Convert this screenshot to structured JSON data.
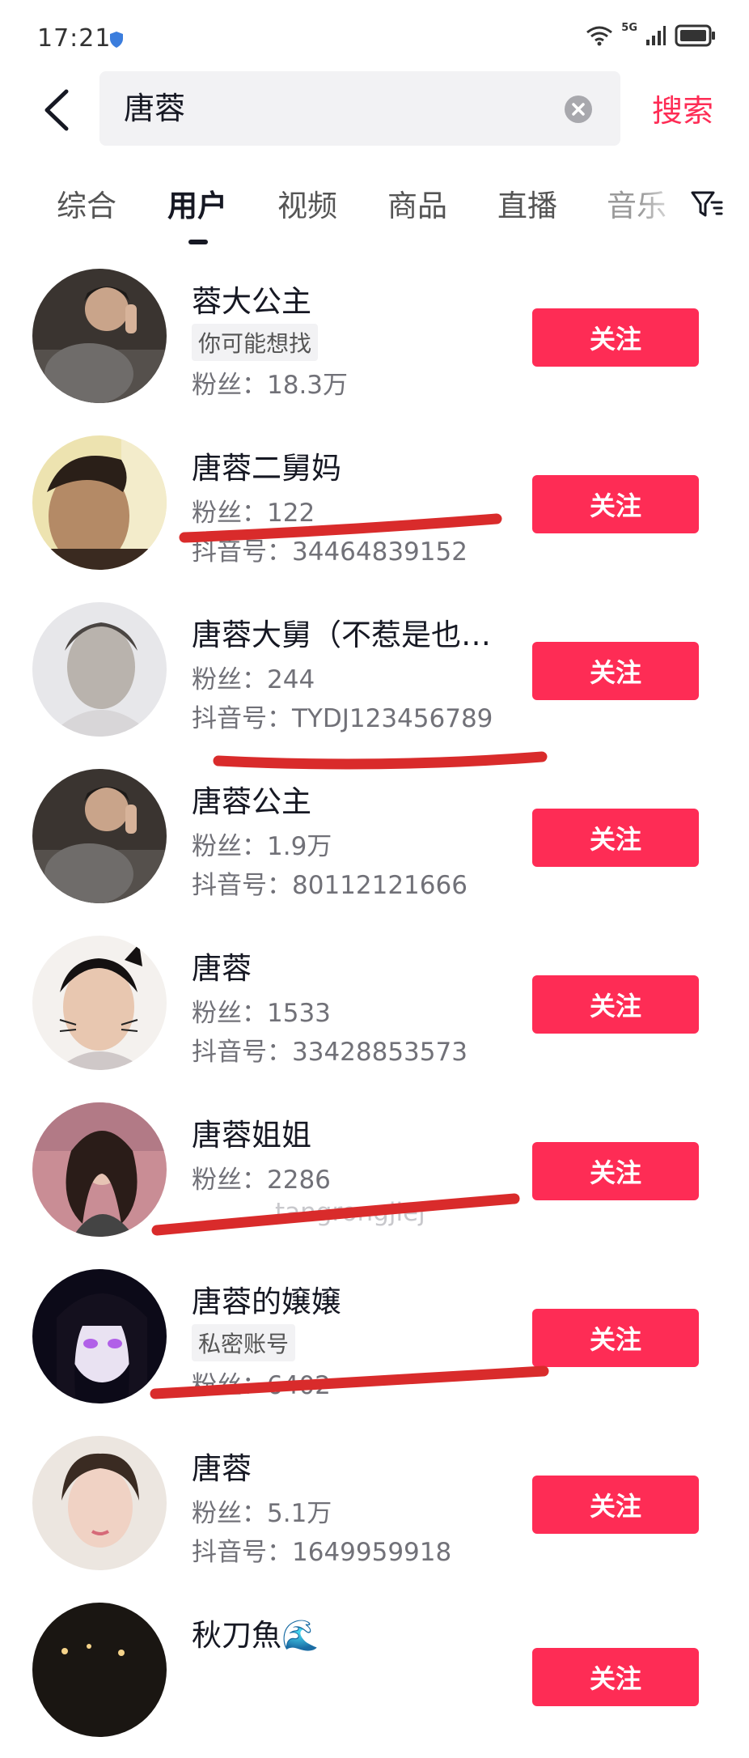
{
  "status_bar": {
    "time": "17:21",
    "network": "5G"
  },
  "search": {
    "query": "唐蓉",
    "submit_label": "搜索"
  },
  "tabs": [
    {
      "label": "综合"
    },
    {
      "label": "用户"
    },
    {
      "label": "视频"
    },
    {
      "label": "商品"
    },
    {
      "label": "直播"
    },
    {
      "label": "音乐"
    }
  ],
  "active_tab": "用户",
  "colors": {
    "accent": "#fe2c55",
    "scribble": "#d92b2b"
  },
  "users": [
    {
      "name": "蓉大公主",
      "tag": "你可能想找",
      "fans": "粉丝：18.3万",
      "follow": "关注"
    },
    {
      "name": "唐蓉二舅妈",
      "fans": "粉丝：122",
      "id": "抖音号：34464839152",
      "follow": "关注"
    },
    {
      "name": "唐蓉大舅（不惹是也…",
      "fans": "粉丝：244",
      "id": "抖音号：TYDJ123456789",
      "follow": "关注"
    },
    {
      "name": "唐蓉公主",
      "fans": "粉丝：1.9万",
      "id": "抖音号：80112121666",
      "follow": "关注"
    },
    {
      "name": "唐蓉",
      "fans": "粉丝：1533",
      "id": "抖音号：33428853573",
      "follow": "关注"
    },
    {
      "name": "唐蓉姐姐",
      "fans": "粉丝：2286",
      "id": "tangrongjiej",
      "follow": "关注"
    },
    {
      "name": "唐蓉的嬢嬢",
      "tag": "私密账号",
      "fans": "粉丝：6402",
      "follow": "关注"
    },
    {
      "name": "唐蓉",
      "fans": "粉丝：5.1万",
      "id": "抖音号：1649959918",
      "follow": "关注"
    },
    {
      "name": "秋刀魚🌊",
      "follow": "关注"
    }
  ]
}
